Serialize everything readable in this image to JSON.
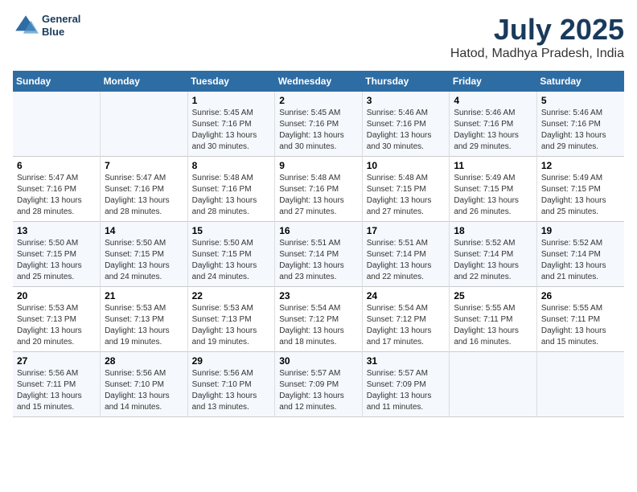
{
  "header": {
    "logo_line1": "General",
    "logo_line2": "Blue",
    "title": "July 2025",
    "subtitle": "Hatod, Madhya Pradesh, India"
  },
  "days_of_week": [
    "Sunday",
    "Monday",
    "Tuesday",
    "Wednesday",
    "Thursday",
    "Friday",
    "Saturday"
  ],
  "weeks": [
    [
      {
        "day": "",
        "info": ""
      },
      {
        "day": "",
        "info": ""
      },
      {
        "day": "1",
        "info": "Sunrise: 5:45 AM\nSunset: 7:16 PM\nDaylight: 13 hours and 30 minutes."
      },
      {
        "day": "2",
        "info": "Sunrise: 5:45 AM\nSunset: 7:16 PM\nDaylight: 13 hours and 30 minutes."
      },
      {
        "day": "3",
        "info": "Sunrise: 5:46 AM\nSunset: 7:16 PM\nDaylight: 13 hours and 30 minutes."
      },
      {
        "day": "4",
        "info": "Sunrise: 5:46 AM\nSunset: 7:16 PM\nDaylight: 13 hours and 29 minutes."
      },
      {
        "day": "5",
        "info": "Sunrise: 5:46 AM\nSunset: 7:16 PM\nDaylight: 13 hours and 29 minutes."
      }
    ],
    [
      {
        "day": "6",
        "info": "Sunrise: 5:47 AM\nSunset: 7:16 PM\nDaylight: 13 hours and 28 minutes."
      },
      {
        "day": "7",
        "info": "Sunrise: 5:47 AM\nSunset: 7:16 PM\nDaylight: 13 hours and 28 minutes."
      },
      {
        "day": "8",
        "info": "Sunrise: 5:48 AM\nSunset: 7:16 PM\nDaylight: 13 hours and 28 minutes."
      },
      {
        "day": "9",
        "info": "Sunrise: 5:48 AM\nSunset: 7:16 PM\nDaylight: 13 hours and 27 minutes."
      },
      {
        "day": "10",
        "info": "Sunrise: 5:48 AM\nSunset: 7:15 PM\nDaylight: 13 hours and 27 minutes."
      },
      {
        "day": "11",
        "info": "Sunrise: 5:49 AM\nSunset: 7:15 PM\nDaylight: 13 hours and 26 minutes."
      },
      {
        "day": "12",
        "info": "Sunrise: 5:49 AM\nSunset: 7:15 PM\nDaylight: 13 hours and 25 minutes."
      }
    ],
    [
      {
        "day": "13",
        "info": "Sunrise: 5:50 AM\nSunset: 7:15 PM\nDaylight: 13 hours and 25 minutes."
      },
      {
        "day": "14",
        "info": "Sunrise: 5:50 AM\nSunset: 7:15 PM\nDaylight: 13 hours and 24 minutes."
      },
      {
        "day": "15",
        "info": "Sunrise: 5:50 AM\nSunset: 7:15 PM\nDaylight: 13 hours and 24 minutes."
      },
      {
        "day": "16",
        "info": "Sunrise: 5:51 AM\nSunset: 7:14 PM\nDaylight: 13 hours and 23 minutes."
      },
      {
        "day": "17",
        "info": "Sunrise: 5:51 AM\nSunset: 7:14 PM\nDaylight: 13 hours and 22 minutes."
      },
      {
        "day": "18",
        "info": "Sunrise: 5:52 AM\nSunset: 7:14 PM\nDaylight: 13 hours and 22 minutes."
      },
      {
        "day": "19",
        "info": "Sunrise: 5:52 AM\nSunset: 7:14 PM\nDaylight: 13 hours and 21 minutes."
      }
    ],
    [
      {
        "day": "20",
        "info": "Sunrise: 5:53 AM\nSunset: 7:13 PM\nDaylight: 13 hours and 20 minutes."
      },
      {
        "day": "21",
        "info": "Sunrise: 5:53 AM\nSunset: 7:13 PM\nDaylight: 13 hours and 19 minutes."
      },
      {
        "day": "22",
        "info": "Sunrise: 5:53 AM\nSunset: 7:13 PM\nDaylight: 13 hours and 19 minutes."
      },
      {
        "day": "23",
        "info": "Sunrise: 5:54 AM\nSunset: 7:12 PM\nDaylight: 13 hours and 18 minutes."
      },
      {
        "day": "24",
        "info": "Sunrise: 5:54 AM\nSunset: 7:12 PM\nDaylight: 13 hours and 17 minutes."
      },
      {
        "day": "25",
        "info": "Sunrise: 5:55 AM\nSunset: 7:11 PM\nDaylight: 13 hours and 16 minutes."
      },
      {
        "day": "26",
        "info": "Sunrise: 5:55 AM\nSunset: 7:11 PM\nDaylight: 13 hours and 15 minutes."
      }
    ],
    [
      {
        "day": "27",
        "info": "Sunrise: 5:56 AM\nSunset: 7:11 PM\nDaylight: 13 hours and 15 minutes."
      },
      {
        "day": "28",
        "info": "Sunrise: 5:56 AM\nSunset: 7:10 PM\nDaylight: 13 hours and 14 minutes."
      },
      {
        "day": "29",
        "info": "Sunrise: 5:56 AM\nSunset: 7:10 PM\nDaylight: 13 hours and 13 minutes."
      },
      {
        "day": "30",
        "info": "Sunrise: 5:57 AM\nSunset: 7:09 PM\nDaylight: 13 hours and 12 minutes."
      },
      {
        "day": "31",
        "info": "Sunrise: 5:57 AM\nSunset: 7:09 PM\nDaylight: 13 hours and 11 minutes."
      },
      {
        "day": "",
        "info": ""
      },
      {
        "day": "",
        "info": ""
      }
    ]
  ]
}
